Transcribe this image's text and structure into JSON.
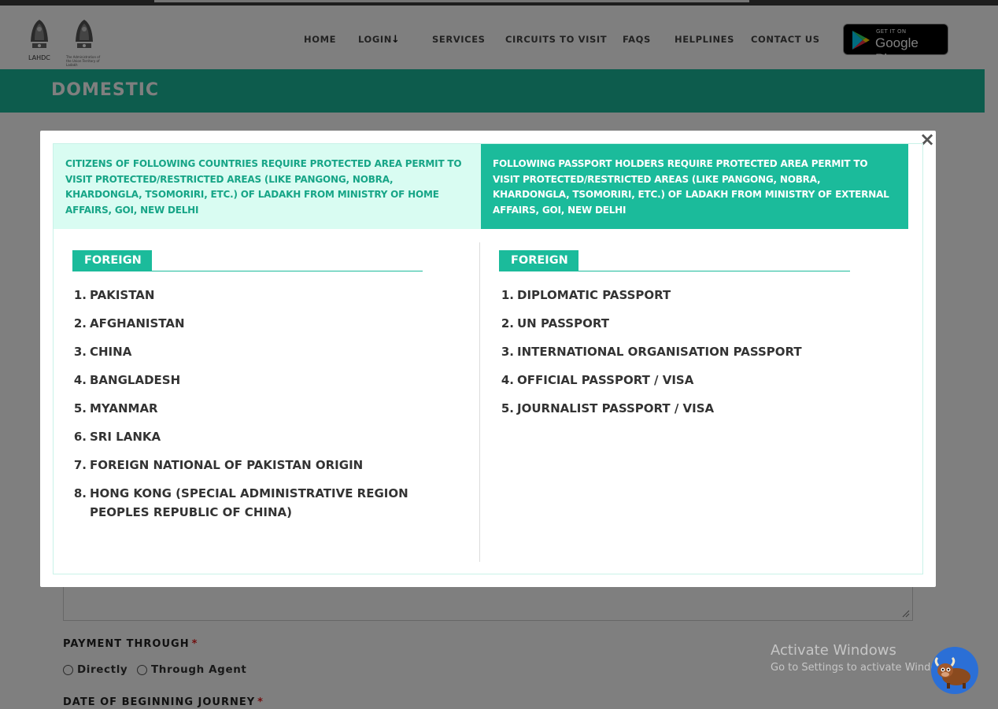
{
  "header": {
    "emblem_caption_1": "LAHDC",
    "emblem_caption_2": "The Administration of the Union Territory of Ladakh",
    "nav": [
      "HOME",
      "LOGIN",
      "SERVICES",
      "CIRCUITS TO VISIT",
      "FAQS",
      "HELPLINES",
      "CONTACT US"
    ],
    "app_badge": {
      "small": "GET IT ON",
      "big": "Google Play"
    }
  },
  "banner": {
    "title": "DOMESTIC"
  },
  "form": {
    "payment_label": "PAYMENT THROUGH",
    "required_mark": "*",
    "payment_options": [
      "Directly",
      "Through Agent"
    ],
    "date_label": "DATE OF BEGINNING JOURNEY"
  },
  "modal": {
    "close": "×",
    "left": {
      "heading": "CITIZENS OF FOLLOWING COUNTRIES REQUIRE PROTECTED AREA PERMIT TO VISIT PROTECTED/RESTRICTED AREAS (LIKE PANGONG, NOBRA, KHARDONGLA, TSOMORIRI, ETC.) OF LADAKH FROM MINISTRY OF HOME AFFAIRS, GOI, NEW DELHI",
      "section": "FOREIGN",
      "items": [
        {
          "num": "1.",
          "text": "PAKISTAN"
        },
        {
          "num": "2.",
          "text": "AFGHANISTAN"
        },
        {
          "num": "3.",
          "text": "CHINA"
        },
        {
          "num": "4.",
          "text": "BANGLADESH"
        },
        {
          "num": "5.",
          "text": "MYANMAR"
        },
        {
          "num": "6.",
          "text": "SRI LANKA"
        },
        {
          "num": "7.",
          "text": "FOREIGN NATIONAL OF PAKISTAN ORIGIN"
        },
        {
          "num": "8.",
          "text": "HONG KONG (SPECIAL ADMINISTRATIVE REGION PEOPLES REPUBLIC OF CHINA)"
        }
      ]
    },
    "right": {
      "heading": "FOLLOWING PASSPORT HOLDERS REQUIRE PROTECTED AREA PERMIT TO VISIT PROTECTED/RESTRICTED AREAS (LIKE PANGONG, NOBRA, KHARDONGLA, TSOMORIRI, ETC.) OF LADAKH FROM MINISTRY OF EXTERNAL AFFAIRS, GOI, NEW DELHI",
      "section": "FOREIGN",
      "items": [
        {
          "num": "1.",
          "text": "DIPLOMATIC PASSPORT"
        },
        {
          "num": "2.",
          "text": "UN PASSPORT"
        },
        {
          "num": "3.",
          "text": "INTERNATIONAL ORGANISATION PASSPORT"
        },
        {
          "num": "4.",
          "text": "OFFICIAL PASSPORT / VISA"
        },
        {
          "num": "5.",
          "text": "JOURNALIST PASSPORT / VISA"
        }
      ]
    }
  },
  "watermark": {
    "line1": "Activate Windows",
    "line2": "Go to Settings to activate Windows."
  },
  "colors": {
    "accent": "#1bbb9b",
    "accent_light": "#d9fcf2",
    "accent_text": "#17a587",
    "required": "#e21d1d"
  },
  "icons": {
    "emblem": "state-emblem-icon",
    "login_arrow": "arrow-down-icon",
    "play": "google-play-icon",
    "close": "close-icon",
    "chat": "yak-chatbot-icon"
  }
}
